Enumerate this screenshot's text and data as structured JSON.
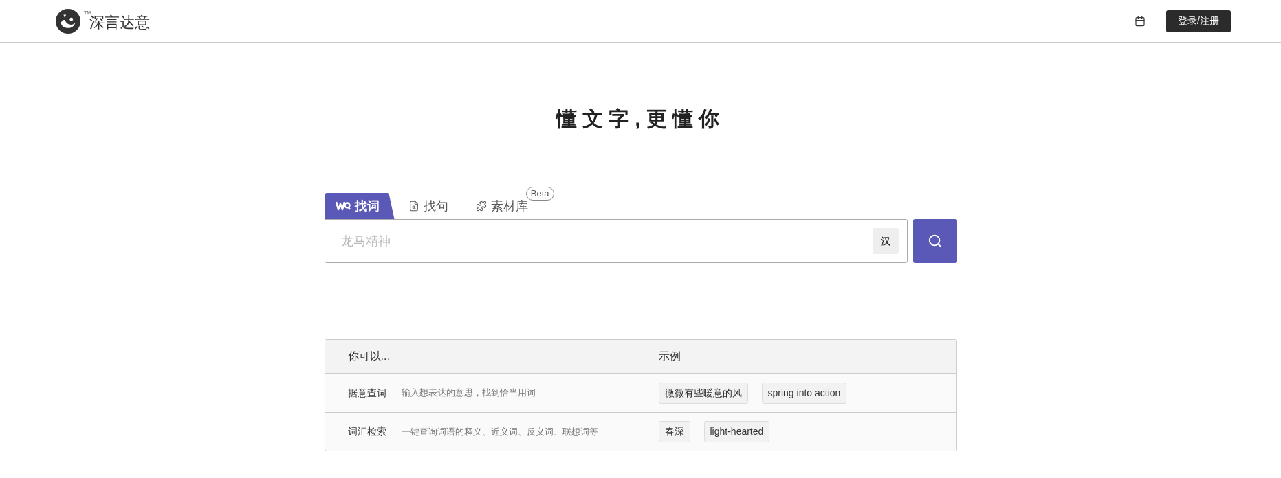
{
  "header": {
    "logo_text": "深言达意",
    "trademark": "TM",
    "login_button": "登录/注册"
  },
  "slogan": "懂文字,更懂你",
  "tabs": [
    {
      "label": "找词",
      "selected": true,
      "kind": "word"
    },
    {
      "label": "找句",
      "selected": false,
      "kind": "sentence"
    },
    {
      "label": "素材库",
      "selected": false,
      "kind": "library",
      "badge": "Beta"
    }
  ],
  "search": {
    "placeholder": "龙马精神",
    "convert_button": "汉"
  },
  "table": {
    "columns": [
      "你可以...",
      "示例"
    ],
    "rows": [
      {
        "feature": "据意查词",
        "description": "输入想表达的意思，找到恰当用词",
        "examples": [
          "微微有些暖意的风",
          "spring into action"
        ]
      },
      {
        "feature": "词汇检索",
        "description": "一键查询词语的释义、近义词、反义词、联想词等",
        "examples": [
          "春深",
          "light-hearted"
        ]
      }
    ]
  }
}
